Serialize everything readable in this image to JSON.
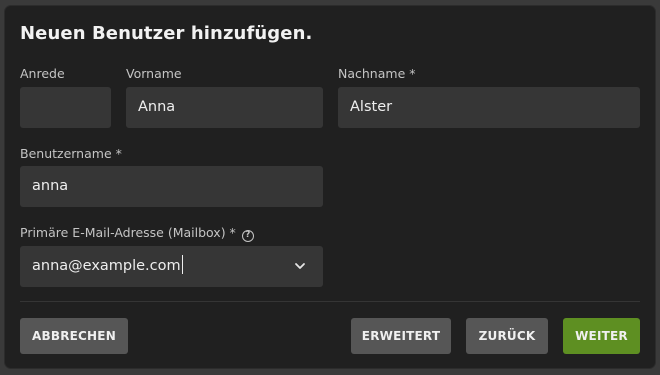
{
  "dialog": {
    "title": "Neuen Benutzer hinzufügen."
  },
  "form": {
    "salutation": {
      "label": "Anrede",
      "value": ""
    },
    "first_name": {
      "label": "Vorname",
      "value": "Anna"
    },
    "last_name": {
      "label": "Nachname *",
      "value": "Alster"
    },
    "username": {
      "label": "Benutzername *",
      "value": "anna"
    },
    "email": {
      "label": "Primäre E-Mail-Adresse (Mailbox) *",
      "help_icon": "?",
      "value": "anna@example.com"
    }
  },
  "buttons": {
    "cancel": "ABBRECHEN",
    "advanced": "ERWEITERT",
    "back": "ZURÜCK",
    "next": "WEITER"
  },
  "colors": {
    "primary": "#5e8f22",
    "button": "#565656",
    "field": "#363636",
    "dialog": "#202020"
  },
  "icons": {
    "help": "help-circle-icon",
    "dropdown": "chevron-down-icon"
  }
}
